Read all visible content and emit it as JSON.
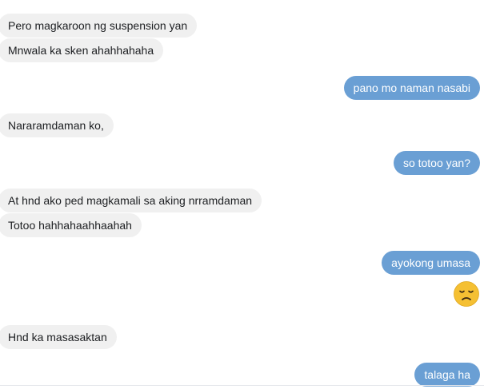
{
  "messages": [
    {
      "side": "in",
      "text": "Pero magkaroon ng suspension yan"
    },
    {
      "side": "in",
      "text": "Mnwala ka sken ahahhahaha"
    },
    {
      "side": "out",
      "text": "pano mo naman nasabi"
    },
    {
      "side": "in",
      "text": "Nararamdaman ko,"
    },
    {
      "side": "out",
      "text": "so totoo yan?"
    },
    {
      "side": "in",
      "text": "At hnd ako ped magkamali sa aking nrramdaman"
    },
    {
      "side": "in",
      "text": "Totoo hahhahaahhaahah"
    },
    {
      "side": "out",
      "text": "ayokong umasa"
    },
    {
      "side": "out",
      "emoji": "disappointed-face-emoji"
    },
    {
      "side": "in",
      "text": "Hnd ka masasaktan"
    },
    {
      "side": "out",
      "text": "talaga ha"
    }
  ],
  "colors": {
    "incoming_bubble": "#f0f0f0",
    "outgoing_bubble": "#6a9fd4",
    "emoji_face": "#f5c033"
  }
}
